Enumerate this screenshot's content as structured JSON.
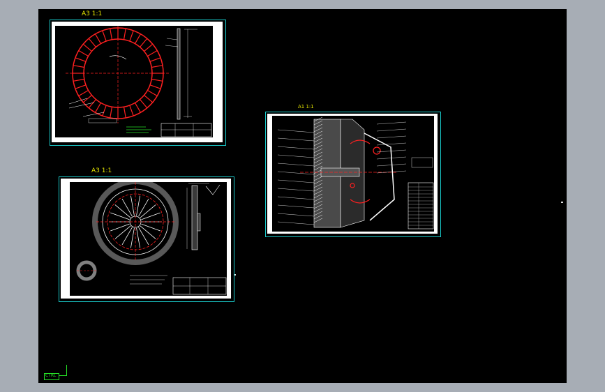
{
  "sheets": {
    "sheet1": {
      "label": "A3  1:1"
    },
    "sheet2": {
      "label": "A3  1:1"
    },
    "sheet3": {
      "label": "A1  1:1"
    }
  },
  "ucs": {
    "label": "CTRL"
  },
  "colors": {
    "model_background": "#000000",
    "app_background": "#a7adb5",
    "sheet_border": "#19c7c7",
    "sheet_label": "#e8e800",
    "drawing_line": "#ffffff",
    "center_line": "#ff2020",
    "note_green": "#26e026"
  }
}
